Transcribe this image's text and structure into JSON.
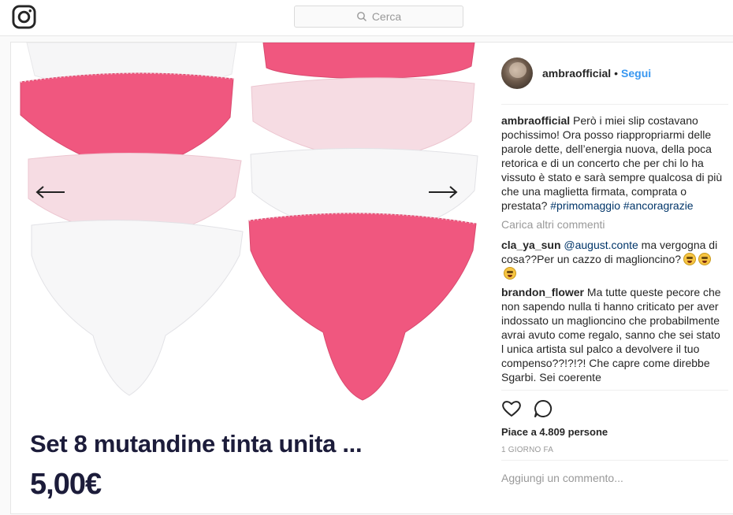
{
  "topbar": {
    "logo_icon": "instagram-icon",
    "search_placeholder": "Cerca",
    "search_icon": "search-icon"
  },
  "media": {
    "product_title": "Set 8 mutandine tinta unita ...",
    "product_price": "5,00€",
    "prev_icon": "arrow-left-icon",
    "next_icon": "arrow-right-icon",
    "colors": {
      "pink": "#f0577f",
      "light_pink": "#f6dce3",
      "white": "#f7f7f8"
    }
  },
  "post": {
    "username": "ambraofficial",
    "separator": "•",
    "follow_label": "Segui",
    "caption": "Però i miei slip costavano pochissimo! Ora posso riappropriarmi delle parole dette, dell’energia nuova, della poca retorica e di un concerto che per chi lo ha vissuto è stato e sarà sempre qualcosa di più che una maglietta firmata, comprata o prestata?",
    "hashtags": "#primomaggio #ancoragrazie",
    "load_more": "Carica altri commenti",
    "comments": [
      {
        "user": "cla_ya_sun",
        "mention": "@august.conte",
        "text": "ma vergogna di cosa??Per un cazzo di maglioncino?"
      },
      {
        "user": "brandon_flower",
        "text": "Ma tutte queste pecore che non sapendo nulla ti hanno criticato per aver indossato un maglioncino che probabilmente avrai avuto come regalo, sanno che sei stato l unica artista sul palco a devolvere il tuo compenso??!?!?! Che capre come direbbe Sgarbi. Sei coerente"
      }
    ],
    "like_icon": "heart-icon",
    "comment_icon": "comment-icon",
    "likes": "Piace a 4.809 persone",
    "time": "1 GIORNO FA",
    "add_comment": "Aggiungi un commento..."
  }
}
